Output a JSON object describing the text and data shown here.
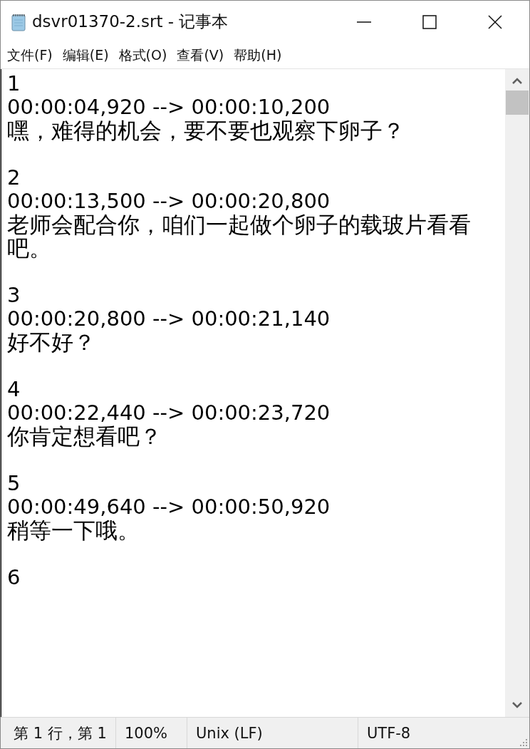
{
  "window": {
    "title": "dsvr01370-2.srt - 记事本"
  },
  "menu": [
    "文件(F)",
    "编辑(E)",
    "格式(O)",
    "查看(V)",
    "帮助(H)"
  ],
  "subtitles": [
    {
      "index": "1",
      "timing": "00:00:04,920 --> 00:00:10,200",
      "text": "嘿，难得的机会，要不要也观察下卵子？"
    },
    {
      "index": "2",
      "timing": "00:00:13,500 --> 00:00:20,800",
      "text": "老师会配合你，咱们一起做个卵子的载玻片看看吧。"
    },
    {
      "index": "3",
      "timing": "00:00:20,800 --> 00:00:21,140",
      "text": "好不好？"
    },
    {
      "index": "4",
      "timing": "00:00:22,440 --> 00:00:23,720",
      "text": "你肯定想看吧？"
    },
    {
      "index": "5",
      "timing": "00:00:49,640 --> 00:00:50,920",
      "text": "稍等一下哦。"
    },
    {
      "index": "6"
    }
  ],
  "status_bar": [
    "第 1 行，第 1",
    "100%",
    "Unix (LF)",
    "UTF-8"
  ]
}
